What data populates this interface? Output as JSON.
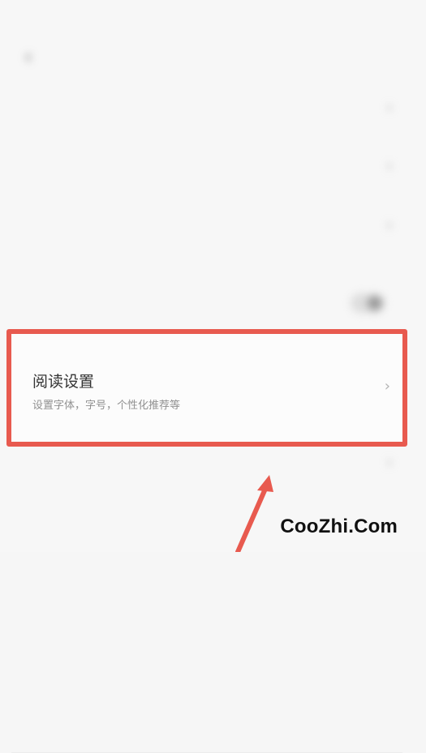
{
  "status": {
    "left_text": "",
    "right_text": ""
  },
  "nav": {
    "back_icon": "chevron-left-icon",
    "title": ""
  },
  "rows": [
    {
      "title": "",
      "subtitle": "",
      "type": "chevron"
    },
    {
      "title": "",
      "subtitle": "",
      "type": "chevron"
    },
    {
      "title": "",
      "subtitle": "",
      "type": "chevron"
    },
    {
      "title": "",
      "subtitle": "",
      "type": "toggle"
    }
  ],
  "highlight": {
    "title": "阅读设置",
    "subtitle": "设置字体，字号，个性化推荐等",
    "chevron": "›"
  },
  "bottom_rows": [
    {
      "title": "",
      "subtitle": "",
      "type": "chevron"
    },
    {
      "title": "",
      "subtitle": "",
      "type": "chevron"
    }
  ],
  "watermark": {
    "text": "CooZhi.Com"
  },
  "colors": {
    "highlight_border": "#e85a4f",
    "background": "#f7f7f7",
    "text_dark": "#333333",
    "text_light": "#909090"
  }
}
